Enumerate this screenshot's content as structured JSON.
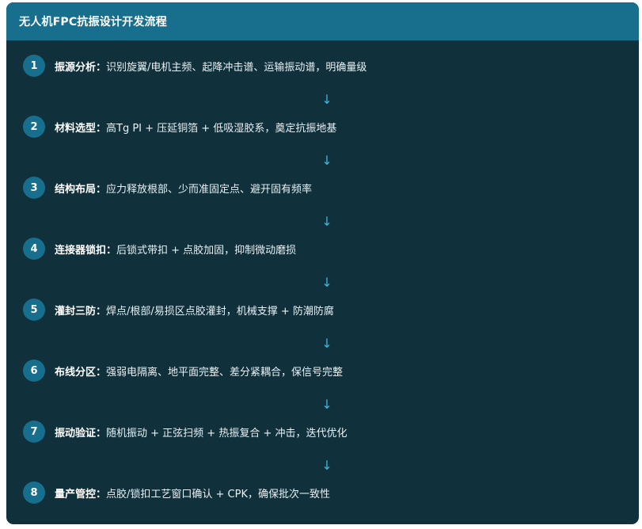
{
  "header": {
    "title": "无人机FPC抗振设计开发流程"
  },
  "colors": {
    "card_bg": "#10303b",
    "accent": "#186f8d",
    "arrow": "#3fb4dc"
  },
  "arrow_glyph": "↓",
  "steps": [
    {
      "num": "1",
      "label": "振源分析：",
      "text": "识别旋翼/电机主频、起降冲击谱、运输振动谱，明确量级"
    },
    {
      "num": "2",
      "label": "材料选型：",
      "text": "高Tg PI + 压延铜箔 + 低吸湿胶系，奠定抗振地基"
    },
    {
      "num": "3",
      "label": "结构布局：",
      "text": "应力释放根部、少而准固定点、避开固有频率"
    },
    {
      "num": "4",
      "label": "连接器锁扣：",
      "text": "后锁式带扣 + 点胶加固，抑制微动磨损"
    },
    {
      "num": "5",
      "label": "灌封三防：",
      "text": "焊点/根部/易损区点胶灌封，机械支撑 + 防潮防腐"
    },
    {
      "num": "6",
      "label": "布线分区：",
      "text": "强弱电隔离、地平面完整、差分紧耦合，保信号完整"
    },
    {
      "num": "7",
      "label": "振动验证：",
      "text": "随机振动 + 正弦扫频 + 热振复合 + 冲击，迭代优化"
    },
    {
      "num": "8",
      "label": "量产管控：",
      "text": "点胶/锁扣工艺窗口确认 + CPK，确保批次一致性"
    }
  ]
}
